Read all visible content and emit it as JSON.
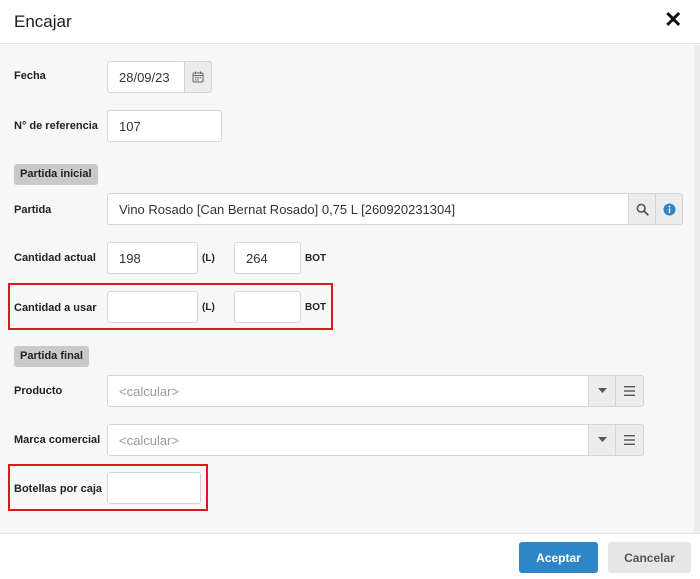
{
  "dialog": {
    "title": "Encajar",
    "close_icon": "close-icon"
  },
  "fields": {
    "fecha": {
      "label": "Fecha",
      "value": "28/09/23"
    },
    "referencia": {
      "label": "N° de referencia",
      "value": "107"
    },
    "partida": {
      "label": "Partida",
      "value": "Vino Rosado [Can Bernat Rosado] 0,75 L [260920231304]"
    },
    "cantidad_actual": {
      "label": "Cantidad actual",
      "value_l": "198",
      "unit_l": "(L)",
      "value_bot": "264",
      "unit_bot": "BOT"
    },
    "cantidad_usar": {
      "label": "Cantidad a usar",
      "value_l": "",
      "unit_l": "(L)",
      "value_bot": "",
      "unit_bot": "BOT"
    },
    "producto": {
      "label": "Producto",
      "placeholder": "<calcular>"
    },
    "marca": {
      "label": "Marca comercial",
      "placeholder": "<calcular>"
    },
    "botellas": {
      "label": "Botellas por caja",
      "value": ""
    }
  },
  "sections": {
    "inicial": "Partida inicial",
    "final": "Partida final"
  },
  "footer": {
    "accept": "Aceptar",
    "cancel": "Cancelar"
  },
  "colors": {
    "primary": "#2f86c6",
    "highlight": "#e0161b",
    "info": "#2f86c6"
  }
}
